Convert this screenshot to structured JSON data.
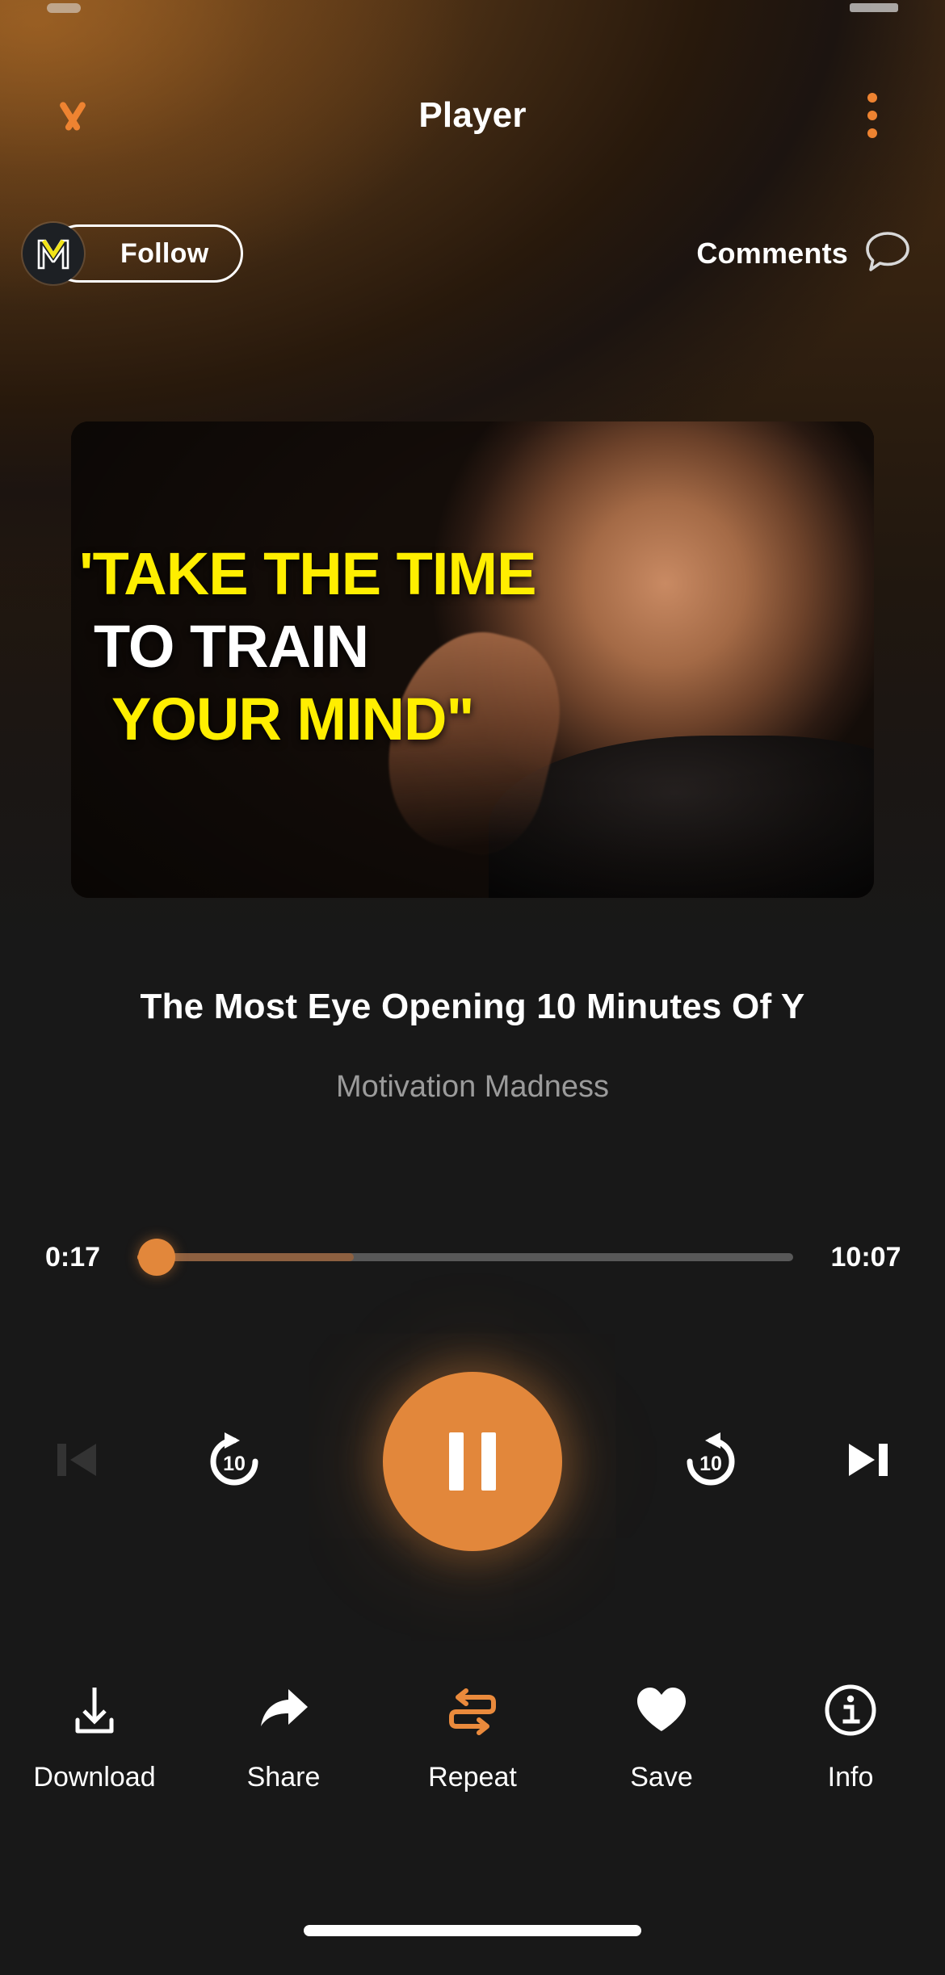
{
  "header": {
    "title": "Player",
    "collapse_icon": "chevron-down-icon",
    "overflow_icon": "kebab-menu-icon"
  },
  "channel": {
    "avatar_icon": "motivation-madness-m-logo",
    "follow_label": "Follow",
    "comments_label": "Comments",
    "comments_icon": "speech-bubble-icon"
  },
  "artwork": {
    "caption_line1": "'TAKE THE TIME",
    "caption_line2": "TO TRAIN",
    "caption_line3": "YOUR MIND\"",
    "caption_color_1": "#ffee00",
    "caption_color_2": "#ffffff",
    "caption_color_3": "#ffee00"
  },
  "track": {
    "title": "The Most Eye Opening 10 Minutes Of Y",
    "artist": "Motivation Madness"
  },
  "progress": {
    "current_time": "0:17",
    "duration": "10:07",
    "percent_played": 3,
    "percent_buffered": 33,
    "accent_color": "#e2873b",
    "track_color": "#585858"
  },
  "controls": {
    "previous_label": "previous-track",
    "previous_icon": "skip-previous-icon",
    "previous_disabled": true,
    "rewind_label": "10",
    "rewind_icon": "replay-10-icon",
    "play_pause_state": "pause",
    "play_pause_icon": "pause-icon",
    "forward_label": "10",
    "forward_icon": "forward-10-icon",
    "next_label": "next-track",
    "next_icon": "skip-next-icon"
  },
  "actions": [
    {
      "label": "Download",
      "icon": "download-icon",
      "active": false
    },
    {
      "label": "Share",
      "icon": "share-icon",
      "active": false
    },
    {
      "label": "Repeat",
      "icon": "repeat-icon",
      "active": true
    },
    {
      "label": "Save",
      "icon": "heart-icon",
      "active": false
    },
    {
      "label": "Info",
      "icon": "info-circle-icon",
      "active": false
    }
  ]
}
